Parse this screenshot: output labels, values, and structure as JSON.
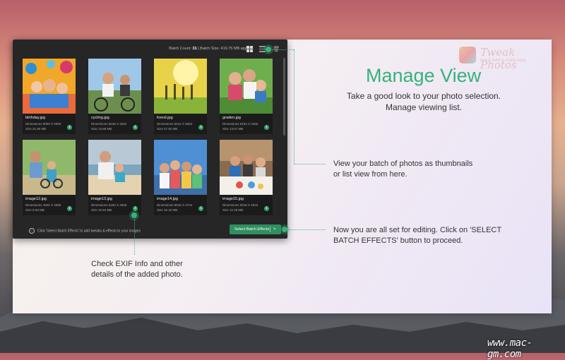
{
  "toolbar": {
    "batch_count_label": "Batch Count:",
    "batch_count_value": "31",
    "batch_size_label": "Batch Size:",
    "batch_size_value": "419.75 MB approx.",
    "separator": "|"
  },
  "photos": [
    {
      "name": "birthday.jpg",
      "dims": "Dimensions 9000 X 6000",
      "size": "Size 21.90 MB"
    },
    {
      "name": "cycling.jpg",
      "dims": "Dimensions 6048 X 4022",
      "size": "Size 13.89 MB"
    },
    {
      "name": "forest.jpg",
      "dims": "Dimensions 6012 X 5664",
      "size": "Size 27.50 MB"
    },
    {
      "name": "graden.jpg",
      "dims": "Dimensions 5184 X 3456",
      "size": "Size 13.07 MB"
    },
    {
      "name": "image12.jpg",
      "dims": "Dimensions 4928 X 3280",
      "size": "Size 8.83 MB"
    },
    {
      "name": "image13.jpg",
      "dims": "Dimensions 6400 X 4848",
      "size": "Size 10.64 MB"
    },
    {
      "name": "image14.jpg",
      "dims": "Dimensions 5616 X 3744",
      "size": "Size 16.18 MB"
    },
    {
      "name": "image15.jpg",
      "dims": "Dimensions 6016 X 4016",
      "size": "Size 12.29 MB"
    }
  ],
  "footer": {
    "hint": "Click 'Select Batch Effects' to add tweaks & effects to your images",
    "select_button": "Select Batch Effects",
    "select_arrow": ">"
  },
  "logo": {
    "name": "Tweak Photos",
    "tagline": "batch editing made easy"
  },
  "tutorial": {
    "title": "Manage View",
    "subtitle_line1": "Take a good look to your photo selection.",
    "subtitle_line2": "Manage viewing list.",
    "note_view_line1": "View your batch of photos as thumbnails",
    "note_view_line2": "or list view from here.",
    "note_select_line1": "Now you are all set for editing. Click on 'SELECT",
    "note_select_line2": "BATCH EFFECTS' button to proceed.",
    "note_exif_line1": "Check EXIF Info and other",
    "note_exif_line2": "details of the added photo."
  },
  "watermark": "www.mac-gm.com",
  "colors": {
    "accent": "#35b27a",
    "button": "#2f8f60",
    "app_bg": "#262626"
  },
  "icons": [
    "grid-view-icon",
    "list-view-icon",
    "trash-icon",
    "info-icon",
    "chevron-right-icon"
  ]
}
